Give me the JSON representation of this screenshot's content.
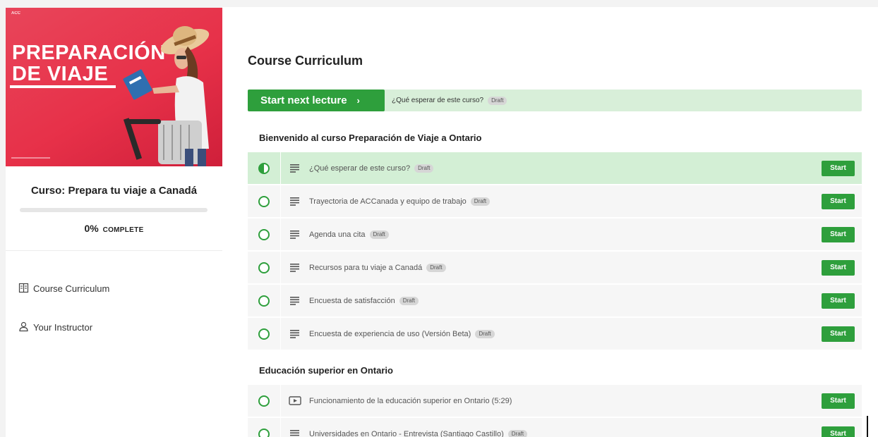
{
  "sidebar": {
    "hero": {
      "brand": "ACC",
      "title_line1": "PREPARACIÓN",
      "title_line2": "DE VIAJE"
    },
    "course_title": "Curso: Prepara tu viaje a Canadá",
    "progress": {
      "percent": 0,
      "percent_text": "0%",
      "complete_word": "COMPLETE"
    },
    "nav": [
      {
        "label": "Course Curriculum",
        "icon": "book-icon"
      },
      {
        "label": "Your Instructor",
        "icon": "user-icon"
      }
    ]
  },
  "main": {
    "title": "Course Curriculum",
    "next": {
      "button_label": "Start next lecture",
      "chevron": "›",
      "lecture_label": "¿Qué esperar de este curso?",
      "draft": "Draft"
    },
    "sections": [
      {
        "title": "Bienvenido al curso Preparación de Viaje a Ontario",
        "lectures": [
          {
            "title": "¿Qué esperar de este curso?",
            "draft": "Draft",
            "type": "text",
            "status": "in-progress",
            "start": "Start"
          },
          {
            "title": "Trayectoria de ACCanada y equipo de trabajo",
            "draft": "Draft",
            "type": "text",
            "status": "not-started",
            "start": "Start"
          },
          {
            "title": "Agenda una cita",
            "draft": "Draft",
            "type": "text",
            "status": "not-started",
            "start": "Start"
          },
          {
            "title": "Recursos para tu viaje a Canadá",
            "draft": "Draft",
            "type": "text",
            "status": "not-started",
            "start": "Start"
          },
          {
            "title": "Encuesta de satisfacción",
            "draft": "Draft",
            "type": "text",
            "status": "not-started",
            "start": "Start"
          },
          {
            "title": "Encuesta de experiencia de uso (Versión Beta)",
            "draft": "Draft",
            "type": "text",
            "status": "not-started",
            "start": "Start"
          }
        ]
      },
      {
        "title": "Educación superior en Ontario",
        "lectures": [
          {
            "title": "Funcionamiento de la educación superior en Ontario (5:29)",
            "type": "video",
            "status": "not-started",
            "start": "Start"
          },
          {
            "title": "Universidades en Ontario - Entrevista (Santiago Castillo)",
            "draft": "Draft",
            "type": "text",
            "status": "not-started",
            "start": "Start"
          }
        ]
      }
    ]
  },
  "colors": {
    "accent": "#2e9f3c",
    "hero": "#e73149",
    "active_row": "#d3efd5"
  }
}
